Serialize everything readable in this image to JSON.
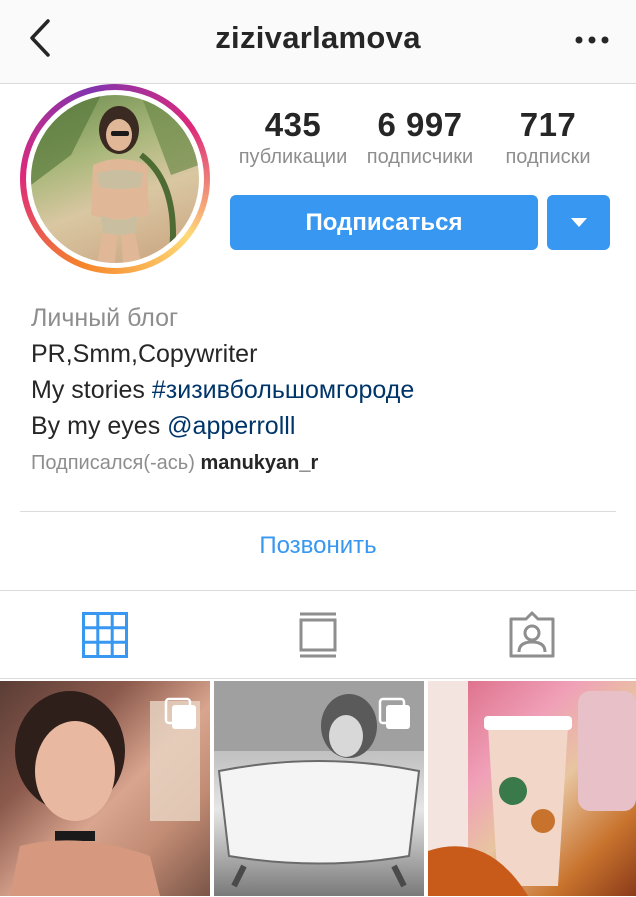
{
  "header": {
    "username": "zizivarlamova",
    "back_icon": "chevron-left-icon",
    "more_icon": "more-horizontal-icon"
  },
  "profile": {
    "stats": [
      {
        "value": "435",
        "label": "публикации"
      },
      {
        "value": "6 997",
        "label": "подписчики"
      },
      {
        "value": "717",
        "label": "подписки"
      }
    ],
    "follow_label": "Подписаться",
    "dropdown_icon": "caret-down-icon",
    "accent_color": "#3897f0"
  },
  "bio": {
    "category": "Личный блог",
    "line1": "PR,Smm,Copywriter",
    "line2_prefix": "My stories ",
    "line2_hashtag": "#зизивбольшомгороде",
    "line3_prefix": "By my eyes ",
    "line3_mention": "@apperrolll",
    "followed_by_prefix": "Подписался(-ась)",
    "followed_by_name": "manukyan_r"
  },
  "actions": {
    "call_label": "Позвонить"
  },
  "tabs": [
    {
      "name": "grid",
      "icon": "grid-icon",
      "active": true
    },
    {
      "name": "feed",
      "icon": "feed-icon",
      "active": false
    },
    {
      "name": "tagged",
      "icon": "tagged-user-icon",
      "active": false
    }
  ],
  "posts": [
    {
      "icon": "multi-photo-icon",
      "multi": true
    },
    {
      "icon": "multi-photo-icon",
      "multi": true
    },
    {
      "multi": false
    }
  ]
}
